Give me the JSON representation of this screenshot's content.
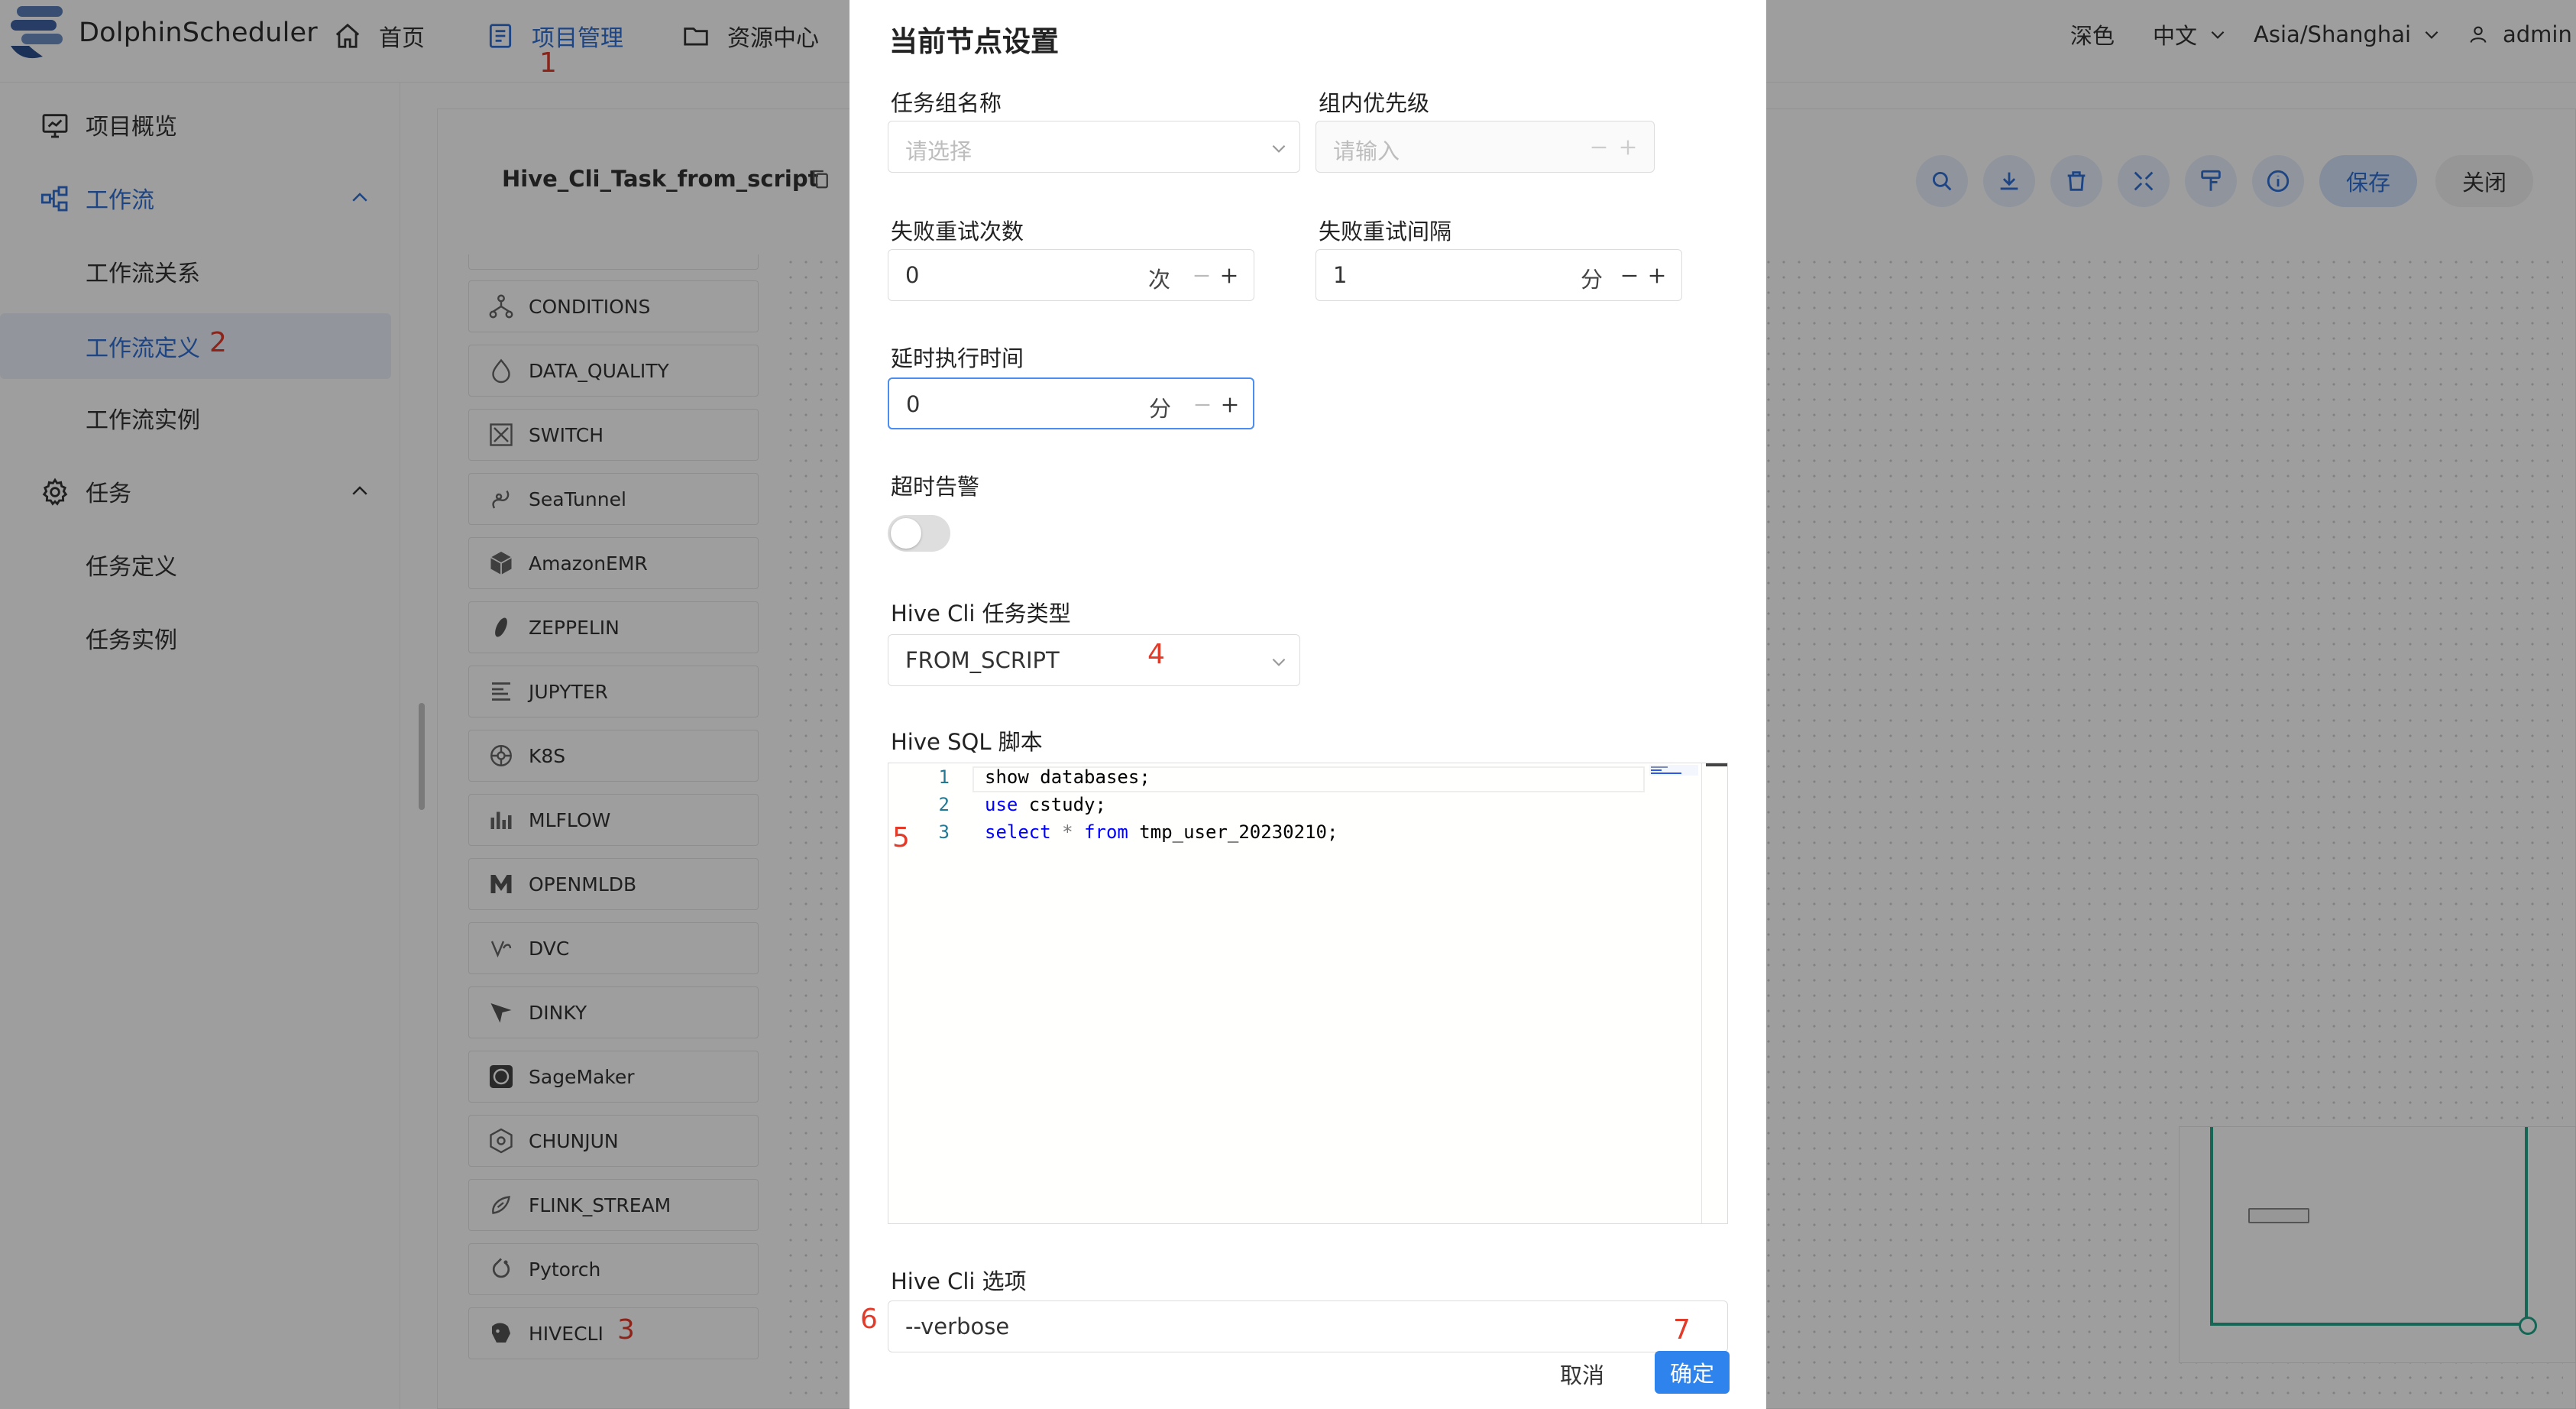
{
  "header": {
    "brand": "DolphinScheduler",
    "nav": [
      {
        "label": "首页",
        "icon": "home-icon"
      },
      {
        "label": "项目管理",
        "icon": "project-icon",
        "active": true
      },
      {
        "label": "资源中心",
        "icon": "folder-icon"
      }
    ],
    "theme": "深色",
    "language": "中文",
    "timezone": "Asia/Shanghai",
    "user": "admin"
  },
  "sidebar": {
    "items": [
      {
        "label": "项目概览",
        "icon": "monitor-icon"
      },
      {
        "label": "工作流",
        "icon": "workflow-icon",
        "expanded": true
      },
      {
        "label": "工作流关系"
      },
      {
        "label": "工作流定义",
        "selected": true
      },
      {
        "label": "工作流实例"
      },
      {
        "label": "任务",
        "icon": "gear-icon",
        "expanded": true
      },
      {
        "label": "任务定义"
      },
      {
        "label": "任务实例"
      }
    ]
  },
  "workspace": {
    "title": "Hive_Cli_Task_from_script",
    "toolbar": [
      "search-icon",
      "download-icon",
      "delete-icon",
      "fullscreen-icon",
      "format-brush-icon",
      "info-icon"
    ],
    "save_label": "保存",
    "close_label": "关闭",
    "tasks": [
      "CONDITIONS",
      "DATA_QUALITY",
      "SWITCH",
      "SeaTunnel",
      "AmazonEMR",
      "ZEPPELIN",
      "JUPYTER",
      "K8S",
      "MLFLOW",
      "OPENMLDB",
      "DVC",
      "DINKY",
      "SageMaker",
      "CHUNJUN",
      "FLINK_STREAM",
      "Pytorch",
      "HIVECLI"
    ]
  },
  "modal": {
    "title": "当前节点设置",
    "task_group_label": "任务组名称",
    "task_group_placeholder": "请选择",
    "priority_label": "组内优先级",
    "priority_placeholder": "请输入",
    "retry_times_label": "失败重试次数",
    "retry_times_value": "0",
    "retry_times_unit": "次",
    "retry_interval_label": "失败重试间隔",
    "retry_interval_value": "1",
    "retry_interval_unit": "分",
    "delay_label": "延时执行时间",
    "delay_value": "0",
    "delay_unit": "分",
    "timeout_label": "超时告警",
    "timeout_enabled": false,
    "hive_type_label": "Hive Cli 任务类型",
    "hive_type_value": "FROM_SCRIPT",
    "script_label": "Hive SQL 脚本",
    "script_lines": [
      {
        "no": "1",
        "text": "show databases;"
      },
      {
        "no": "2",
        "kw": "use",
        "text": " cstudy;"
      },
      {
        "no": "3",
        "kw": "select",
        "op": "*",
        "kw2": "from",
        "text": " tmp_user_20230210;"
      }
    ],
    "options_label": "Hive Cli 选项",
    "options_value": "--verbose",
    "cancel_label": "取消",
    "confirm_label": "确定"
  },
  "annotations": [
    "1",
    "2",
    "3",
    "4",
    "5",
    "6",
    "7"
  ],
  "colors": {
    "accent": "#2f6ed3",
    "primary_button": "#2f83ec",
    "annotation": "#e23b2a",
    "minimap_frame": "#22a58a"
  }
}
